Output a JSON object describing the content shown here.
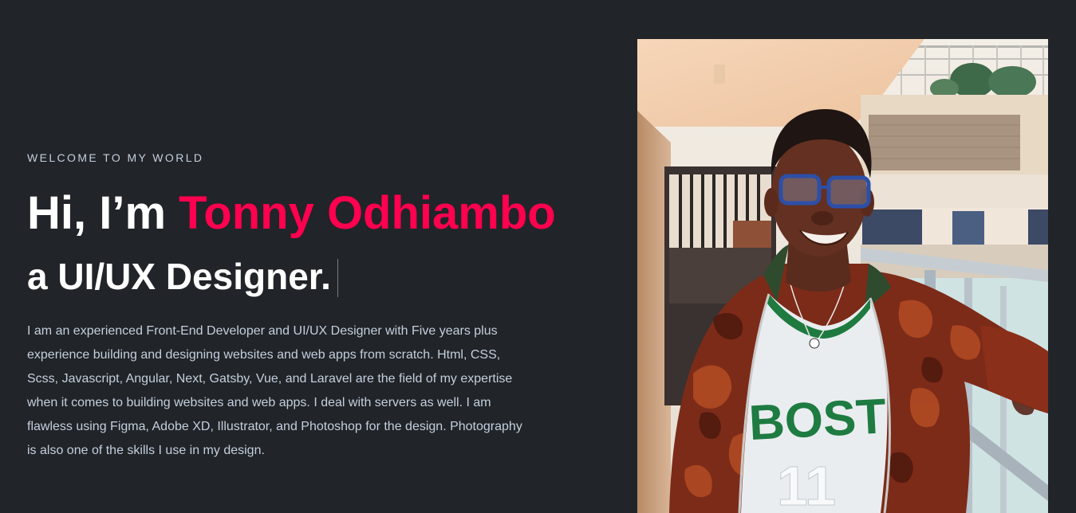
{
  "hero": {
    "eyebrow": "WELCOME TO MY WORLD",
    "greeting": "Hi, I’m ",
    "name": "Tonny Odhiambo",
    "role_line": "a UI/UX Designer.",
    "bio": "I am an experienced Front-End Developer and UI/UX Designer with Five years plus experience building and designing websites and web apps from scratch. Html, CSS, Scss, Javascript, Angular, Next, Gatsby, Vue, and Laravel are the field of my expertise when it comes to building websites and web apps. I deal with servers as well. I am flawless using Figma, Adobe XD, Illustrator, and Photoshop for the design. Photography is also one of the skills I use in my design."
  },
  "photo": {
    "shirt_text": "BOST",
    "shirt_number": "11"
  },
  "colors": {
    "background": "#212428",
    "accent": "#ff014f",
    "body_text": "#c4cfde"
  }
}
